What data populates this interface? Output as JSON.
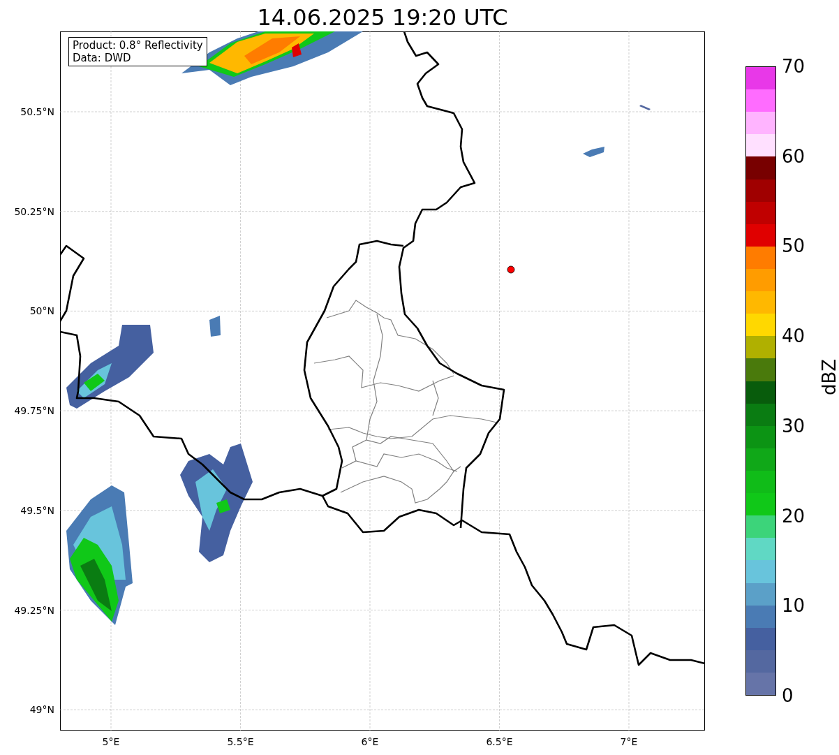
{
  "title": "14.06.2025 19:20 UTC",
  "annotation": [
    "Product: 0.8° Reflectivity",
    "Data: DWD"
  ],
  "map": {
    "kind": "map",
    "marker": {
      "color": "#ff0000"
    }
  },
  "x_ticks": [
    "5°E",
    "5.5°E",
    "6°E",
    "6.5°E",
    "7°E"
  ],
  "y_ticks": [
    "50.5°N",
    "50.25°N",
    "50°N",
    "49.75°N",
    "49.5°N",
    "49.25°N",
    "49°N"
  ],
  "colorbar": {
    "label": "dBZ",
    "ticks": [
      "70",
      "60",
      "50",
      "40",
      "30",
      "20",
      "10",
      "0"
    ],
    "bins": [
      {
        "color": "#e838e8"
      },
      {
        "color": "#ff6cff"
      },
      {
        "color": "#ffb4ff"
      },
      {
        "color": "#ffe0ff"
      },
      {
        "color": "#780000"
      },
      {
        "color": "#a00000"
      },
      {
        "color": "#c00000"
      },
      {
        "color": "#e00000"
      },
      {
        "color": "#ff7c00"
      },
      {
        "color": "#ff9c00"
      },
      {
        "color": "#ffb800"
      },
      {
        "color": "#ffd800"
      },
      {
        "color": "#b0b000"
      },
      {
        "color": "#4a7a0c"
      },
      {
        "color": "#085c0c"
      },
      {
        "color": "#0a7c12"
      },
      {
        "color": "#0c9414"
      },
      {
        "color": "#10a818"
      },
      {
        "color": "#10bc18"
      },
      {
        "color": "#10c818"
      },
      {
        "color": "#3cd47a"
      },
      {
        "color": "#60d8c4"
      },
      {
        "color": "#68c4dc"
      },
      {
        "color": "#5ba0c8"
      },
      {
        "color": "#4a7bb4"
      },
      {
        "color": "#4560a0"
      },
      {
        "color": "#5468a0"
      },
      {
        "color": "#6674a8"
      }
    ]
  }
}
